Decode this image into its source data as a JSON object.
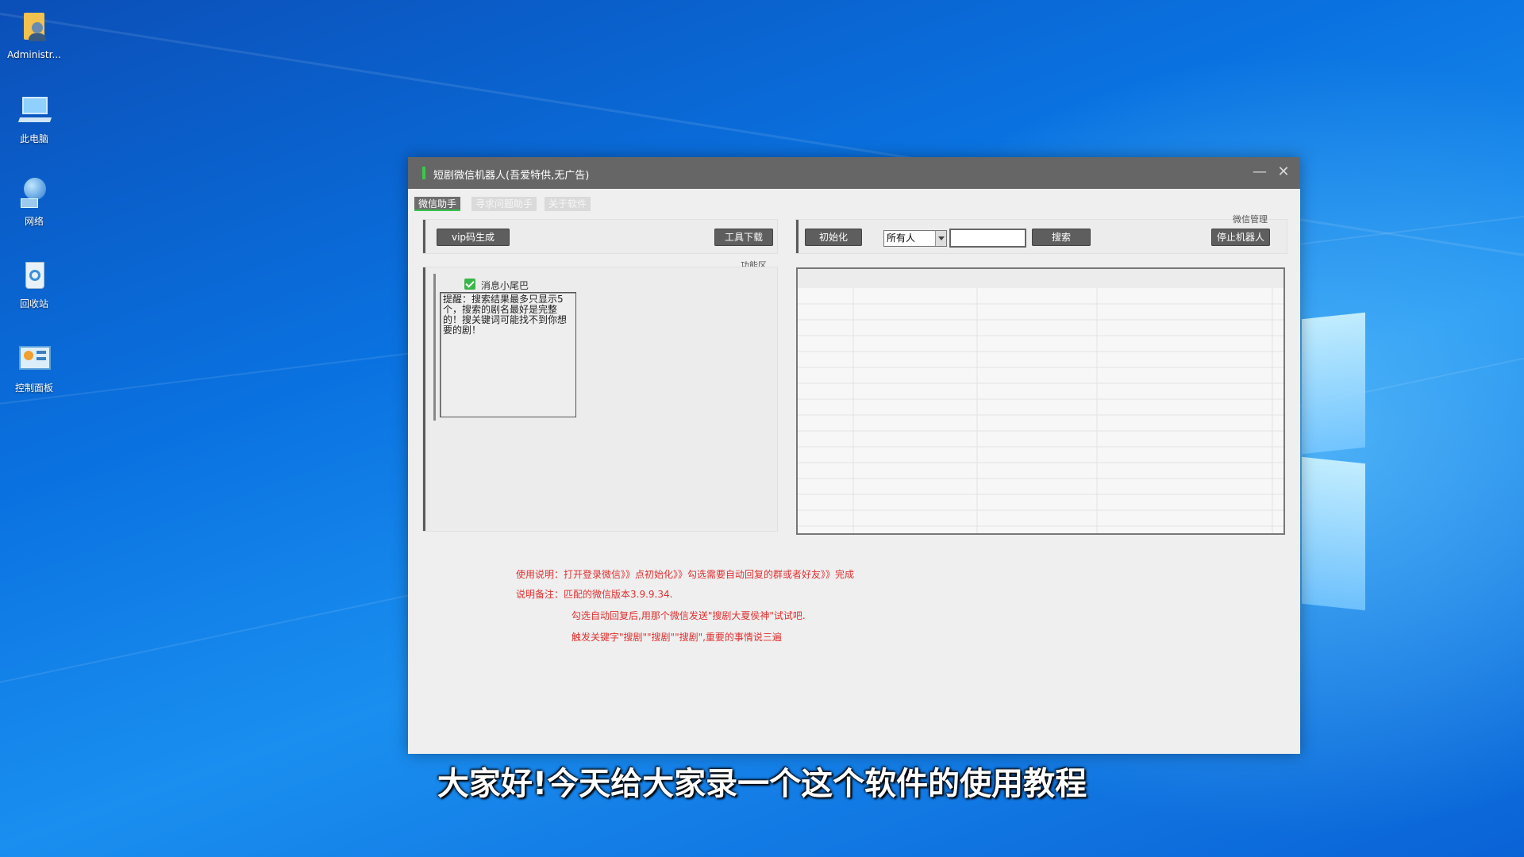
{
  "desktop": {
    "icons": [
      {
        "label": "Administr..."
      },
      {
        "label": "此电脑"
      },
      {
        "label": "网络"
      },
      {
        "label": "回收站"
      },
      {
        "label": "控制面板"
      }
    ]
  },
  "window": {
    "title": "短剧微信机器人(吾爱特供,无广告)",
    "minimize": "—",
    "close": "✕",
    "tabs": [
      {
        "label": "微信助手",
        "active": true
      },
      {
        "label": "寻求问题助手",
        "active": false
      },
      {
        "label": "关于软件",
        "active": false
      }
    ]
  },
  "left_panel": {
    "vip_button": "vip码生成",
    "download_button": "工具下载",
    "section_label": "功能区",
    "checkbox_label": "消息小尾巴",
    "checkbox_checked": true,
    "textarea_value": "提醒：搜索结果最多只显示5个，搜索的剧名最好是完整的！搜关键词可能找不到你想要的剧！"
  },
  "right_panel": {
    "section_label": "微信管理",
    "init_button": "初始化",
    "select_value": "所有人",
    "search_value": "",
    "search_button": "搜索",
    "stop_button": "停止机器人"
  },
  "notes": {
    "line1": "使用说明：打开登录微信》》点初始化》》勾选需要自动回复的群或者好友》》完成",
    "line2": "说明备注：匹配的微信版本3.9.9.34.",
    "line3": "勾选自动回复后,用那个微信发送\"搜剧大夏侯神\"试试吧.",
    "line4": "触发关键字\"搜剧\"\"搜剧\"\"搜剧\",重要的事情说三遍"
  },
  "subtitle": "大家好!今天给大家录一个这个软件的使用教程",
  "colors": {
    "accent_green": "#39c94a",
    "note_red": "#e03030",
    "title_bar": "#666666"
  }
}
